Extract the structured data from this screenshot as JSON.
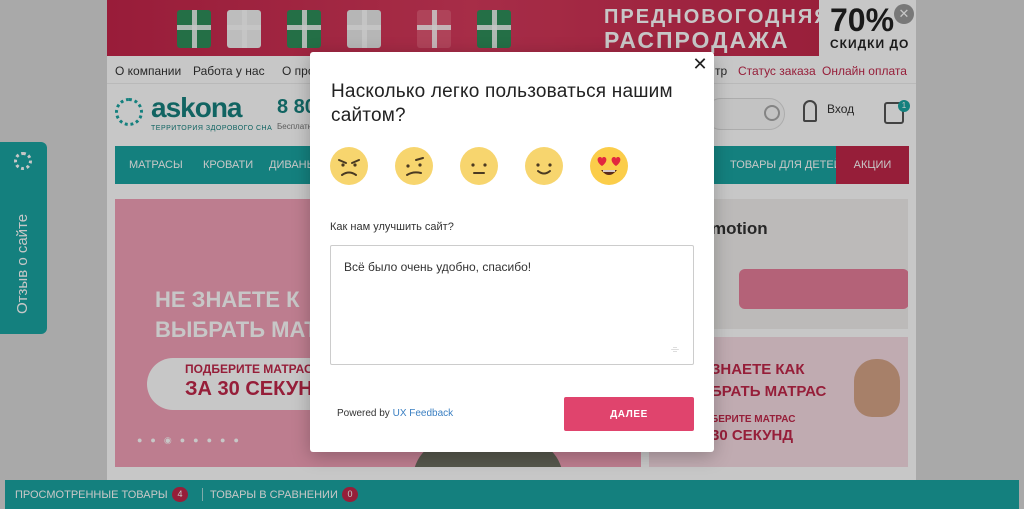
{
  "promo": {
    "line1": "ПРЕДНОВОГОДНЯЯ",
    "line2": "РАСПРОДАЖА",
    "percent": "70%",
    "sub": "СКИДКИ ДО",
    "close_glyph": "✕"
  },
  "topnav": {
    "about": "О компании",
    "jobs": "Работа у нас",
    "partial": "О про",
    "partial_right": "тр",
    "order_status": "Статус заказа",
    "online_pay": "Онлайн оплата"
  },
  "header": {
    "logo": "askona",
    "logo_sub": "ТЕРРИТОРИЯ ЗДОРОВОГО СНА",
    "phone": "8 80",
    "phone_sub": "Бесплатн",
    "login": "Вход",
    "cart_count": "1"
  },
  "catnav": {
    "mattresses": "МАТРАСЫ",
    "beds": "КРОВАТИ",
    "sofas": "ДИВАНЫ",
    "kids": "ТОВАРЫ ДЛЯ ДЕТЕЙ",
    "sale": "АКЦИИ"
  },
  "hero": {
    "line1": "НЕ ЗНАЕТЕ К",
    "line2": "ВЫБРАТЬ МАТ",
    "pill1": "ПОДБЕРИТЕ МАТРАС",
    "pill2": "ЗА 30 СЕКУНД",
    "dots": "●●◉●●●●●"
  },
  "side1": {
    "title": "motion"
  },
  "side2": {
    "line1": "ЗНАЕТЕ КАК",
    "line2": "БРАТЬ МАТРАС",
    "pill1": "БЕРИТЕ МАТРАС",
    "pill2": "30 СЕКУНД"
  },
  "feedback_tab": {
    "label": "Отзыв о сайте"
  },
  "bottom_bar": {
    "viewed": "ПРОСМОТРЕННЫЕ ТОВАРЫ",
    "viewed_count": "4",
    "compare": "ТОВАРЫ В СРАВНЕНИИ",
    "compare_count": "0"
  },
  "modal": {
    "close_glyph": "✕",
    "question": "Насколько легко пользоваться нашим сайтом?",
    "improve_label": "Как нам улучшить сайт?",
    "feedback_text": "Всё было очень удобно, спасибо!",
    "powered_prefix": "Powered by ",
    "powered_link": "UX Feedback",
    "next_label": "ДАЛЕЕ",
    "ratings": [
      "angry-face-icon",
      "confused-face-icon",
      "neutral-face-icon",
      "smiling-face-icon",
      "heart-eyes-face-icon"
    ],
    "accent": "#e0446d",
    "brand": "#1aa5a2"
  }
}
